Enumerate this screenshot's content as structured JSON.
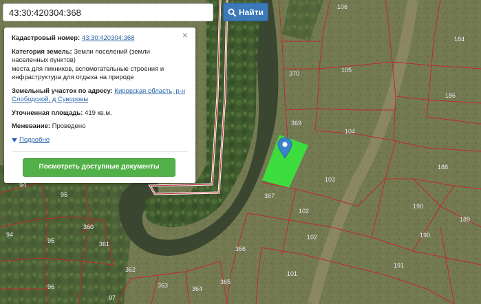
{
  "search": {
    "value": "43:30:420304:368",
    "button_label": "Найти"
  },
  "popup": {
    "close_symbol": "×",
    "cadastral_label": "Кадастровый номер:",
    "cadastral_value": "43:30:420304:368",
    "category_label": "Категория земель:",
    "category_value": "Земли поселений (земли населенных пунктов)",
    "usage_text": "места для пикников, вспомогательные строения и инфраструктура для отдыха на природе",
    "address_label": "Земельный участок по адресу:",
    "address_value": "Кировская область, р-н Слободской, д Суворовы",
    "area_label": "Уточненная площадь:",
    "area_value": "419 кв.м.",
    "survey_label": "Межевание:",
    "survey_value": "Проведено",
    "details_link": "Подробно",
    "documents_button": "Посмотреть доступные документы"
  },
  "map": {
    "boundary_color": "#c0282a",
    "selected_parcel_color": "#39e53d",
    "marker_color": "#3b83c9",
    "parcel_labels": [
      "106",
      "184",
      "370",
      "105",
      "186",
      "369",
      "104",
      "188",
      "103",
      "367",
      "190",
      "102",
      "189",
      "190",
      "102",
      "366",
      "191",
      "101",
      "94",
      "95",
      "360",
      "361",
      "94",
      "95",
      "362",
      "365",
      "363",
      "364",
      "96",
      "97"
    ]
  }
}
